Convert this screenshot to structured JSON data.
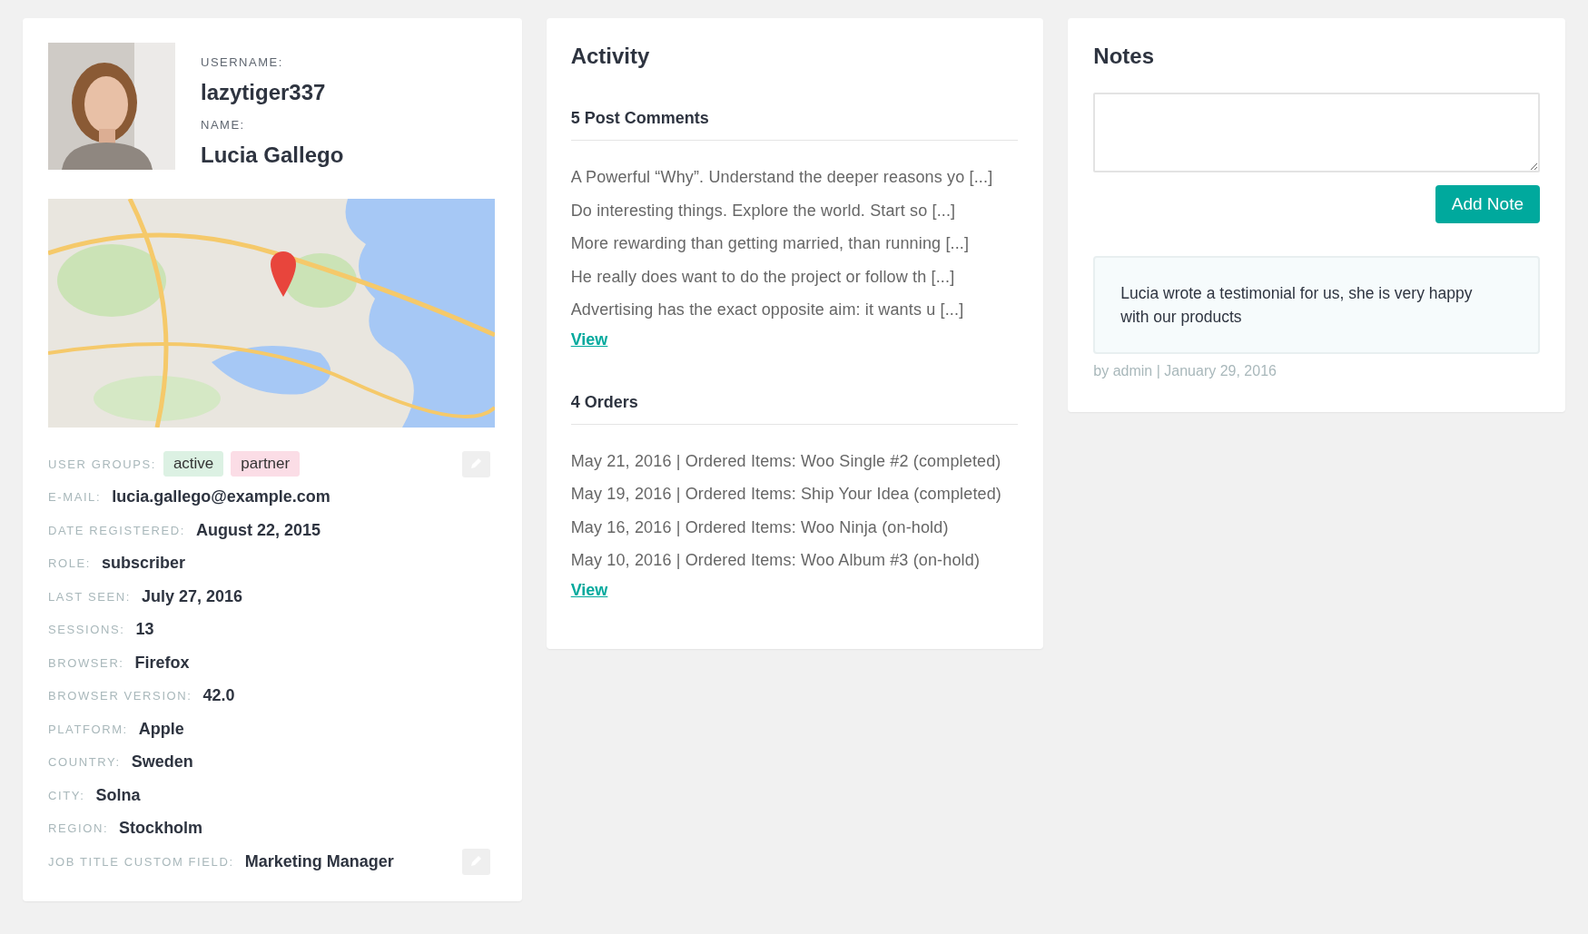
{
  "profile": {
    "username_label": "USERNAME:",
    "username": "lazytiger337",
    "name_label": "NAME:",
    "name": "Lucia Gallego",
    "groups": {
      "label": "USER GROUPS:",
      "editable": true,
      "tags": [
        {
          "text": "active",
          "color": "#dcf1e3"
        },
        {
          "text": "partner",
          "color": "#fbdde6"
        }
      ]
    },
    "fields": [
      {
        "label": "E-MAIL:",
        "value": "lucia.gallego@example.com",
        "editable": false
      },
      {
        "label": "DATE REGISTERED:",
        "value": "August 22, 2015",
        "editable": false
      },
      {
        "label": "ROLE:",
        "value": "subscriber",
        "editable": false
      },
      {
        "label": "LAST SEEN:",
        "value": "July 27, 2016",
        "editable": false
      },
      {
        "label": "SESSIONS:",
        "value": "13",
        "editable": false
      },
      {
        "label": "BROWSER:",
        "value": "Firefox",
        "editable": false
      },
      {
        "label": "BROWSER VERSION:",
        "value": "42.0",
        "editable": false
      },
      {
        "label": "PLATFORM:",
        "value": "Apple",
        "editable": false
      },
      {
        "label": "COUNTRY:",
        "value": "Sweden",
        "editable": false
      },
      {
        "label": "CITY:",
        "value": "Solna",
        "editable": false
      },
      {
        "label": "REGION:",
        "value": "Stockholm",
        "editable": false
      },
      {
        "label": "JOB TITLE CUSTOM FIELD:",
        "value": "Marketing Manager",
        "editable": true
      }
    ]
  },
  "activity": {
    "title": "Activity",
    "sections": [
      {
        "title": "5 Post Comments",
        "items": [
          "A Powerful “Why”. Understand the deeper reasons yo [...]",
          "Do interesting things. Explore the world. Start so [...]",
          "More rewarding than getting married, than running [...]",
          "He really does want to do the project or follow th [...]",
          "Advertising has the exact opposite aim: it wants u [...]"
        ],
        "link": "View"
      },
      {
        "title": "4 Orders",
        "items": [
          "May 21, 2016 | Ordered Items: Woo Single #2 (completed)",
          "May 19, 2016 | Ordered Items: Ship Your Idea (completed)",
          "May 16, 2016 | Ordered Items: Woo Ninja (on-hold)",
          "May 10, 2016 | Ordered Items: Woo Album #3 (on-hold)"
        ],
        "link": "View"
      }
    ]
  },
  "notes": {
    "title": "Notes",
    "button": "Add Note",
    "entries": [
      {
        "text": "Lucia wrote a testimonial for us, she is very happy with our products",
        "meta": "by admin | January 29, 2016"
      }
    ]
  }
}
